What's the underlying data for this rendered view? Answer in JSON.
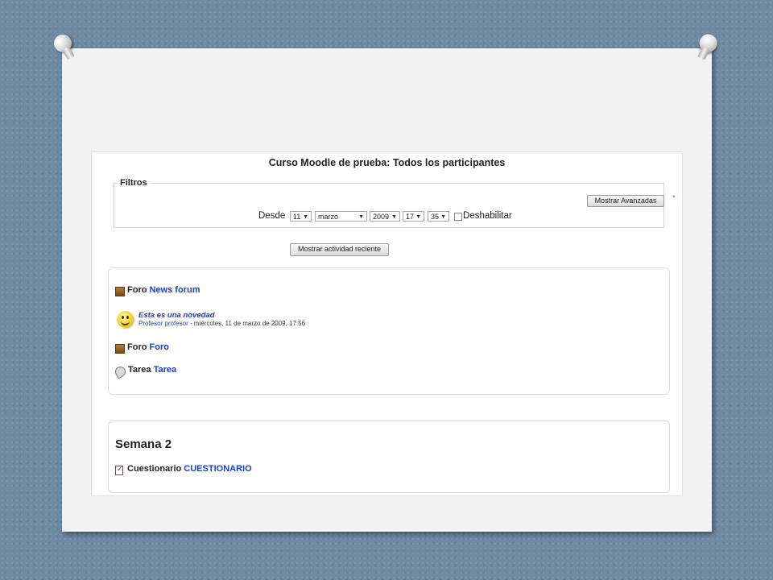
{
  "page": {
    "title": "Curso Moodle de prueba: Todos los participantes"
  },
  "filters": {
    "legend": "Filtros",
    "asterisk": "*",
    "advanced_button": "Mostrar Avanzadas",
    "desde_label": "Desde",
    "day": "11",
    "month": "marzo",
    "year": "2009",
    "hour": "17",
    "minute": "35",
    "disable_label": "Deshabilitar"
  },
  "recent_button": "Mostrar actividad reciente",
  "section1": {
    "items": [
      {
        "module": "Foro",
        "name": "News forum"
      },
      {
        "module": "Foro",
        "name": "Foro"
      },
      {
        "module": "Tarea",
        "name": "Tarea"
      }
    ],
    "post": {
      "title": "Esta es una novedad",
      "author": "Profesor profesor",
      "meta": " - miércoles, 11 de marzo de 2009, 17:56"
    }
  },
  "section2": {
    "heading": "Semana 2",
    "item": {
      "module": "Cuestionario",
      "name": "CUESTIONARIO"
    }
  },
  "icons": [
    "forum-icon",
    "smiley-icon",
    "assignment-icon",
    "quiz-icon",
    "pushpin-icon"
  ],
  "colors": {
    "link": "#1a3fd6",
    "background": "#6f8aa3",
    "slide": "#f2f2f2"
  }
}
